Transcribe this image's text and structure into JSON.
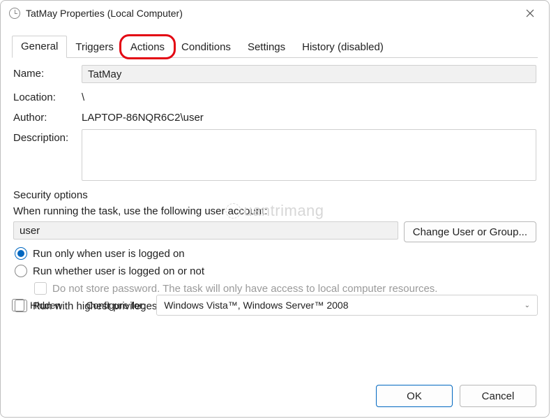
{
  "window": {
    "title": "TatMay Properties (Local Computer)"
  },
  "tabs": {
    "general": "General",
    "triggers": "Triggers",
    "actions": "Actions",
    "conditions": "Conditions",
    "settings": "Settings",
    "history": "History (disabled)"
  },
  "form": {
    "name_label": "Name:",
    "name_value": "TatMay",
    "location_label": "Location:",
    "location_value": "\\",
    "author_label": "Author:",
    "author_value": "LAPTOP-86NQR6C2\\user",
    "description_label": "Description:"
  },
  "security": {
    "heading": "Security options",
    "when_running": "When running the task, use the following user account:",
    "user": "user",
    "change_btn": "Change User or Group...",
    "run_logged_on": "Run only when user is logged on",
    "run_whether": "Run whether user is logged on or not",
    "no_store": "Do not store password.  The task will only have access to local computer resources.",
    "highest": "Run with highest privileges"
  },
  "bottom": {
    "hidden": "Hidden",
    "configure_for": "Configure for:",
    "configure_value": "Windows Vista™, Windows Server™ 2008"
  },
  "buttons": {
    "ok": "OK",
    "cancel": "Cancel"
  },
  "watermark": "uantrimang"
}
